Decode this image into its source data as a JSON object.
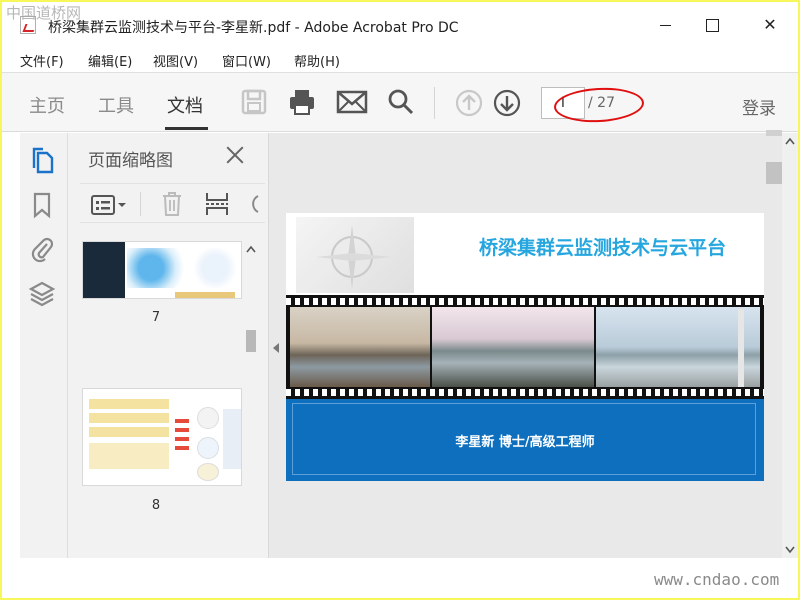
{
  "window": {
    "title": "桥梁集群云监测技术与平台-李星新.pdf - Adobe Acrobat Pro DC",
    "minimize_icon": "minimize-icon",
    "maximize_icon": "maximize-icon",
    "close_label": "✕"
  },
  "menu": [
    "文件(F)",
    "编辑(E)",
    "视图(V)",
    "窗口(W)",
    "帮助(H)"
  ],
  "tabs": [
    {
      "label": "主页",
      "active": false
    },
    {
      "label": "工具",
      "active": false
    },
    {
      "label": "文档",
      "active": true
    }
  ],
  "toolbar": {
    "icons": [
      "save-icon",
      "print-icon",
      "email-icon",
      "search-icon",
      "page-up-icon",
      "page-down-icon"
    ],
    "current_page": "I",
    "total_pages": "/ 27",
    "login_label": "登录"
  },
  "left_rail": {
    "icons": [
      "page-thumbnails-icon",
      "bookmarks-icon",
      "attachments-icon",
      "layers-icon"
    ],
    "active_color": "#1a73c8"
  },
  "thumbnail_panel": {
    "title": "页面缩略图",
    "tool_icons": [
      "options-menu-icon",
      "delete-icon",
      "extract-icon",
      "rotate-icon"
    ],
    "pages": [
      {
        "number": "7"
      },
      {
        "number": "8"
      }
    ]
  },
  "slide": {
    "title": "桥梁集群云监测技术与云平台",
    "author": "李星新  博士/高级工程师",
    "title_color": "#25a6df",
    "band_color": "#0d6fbd"
  },
  "watermarks": {
    "top_left": "中国道桥网",
    "bottom_right": "www.cndao.com"
  }
}
